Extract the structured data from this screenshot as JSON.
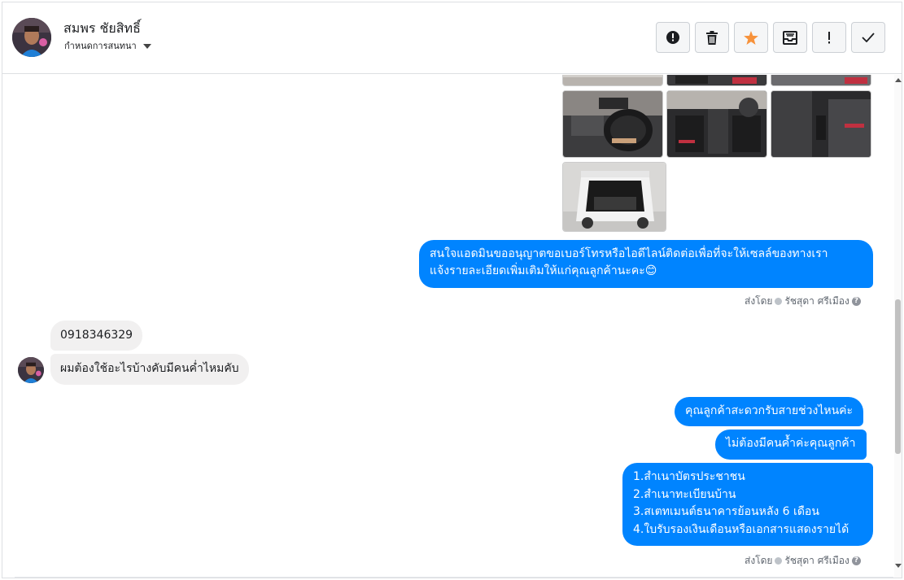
{
  "header": {
    "contact_name": "สมพร ชัยสิทธิ์",
    "label_text": "กำหนดการสนทนา"
  },
  "toolbar": [
    {
      "name": "report-spam-button",
      "icon": "exclamation-circle-icon"
    },
    {
      "name": "delete-button",
      "icon": "trash-icon"
    },
    {
      "name": "star-button",
      "icon": "star-icon",
      "color": "#f7923b"
    },
    {
      "name": "move-to-done-button",
      "icon": "inbox-icon"
    },
    {
      "name": "mark-unread-button",
      "icon": "exclamation-icon"
    },
    {
      "name": "done-button",
      "icon": "checkmark-icon"
    }
  ],
  "messages": {
    "page_1": "สนใจแอดมินขออนุญาตขอเบอร์โทรหรือไอดีไลน์ติดต่อเพื่อที่จะให้เซลล์ของทางเรา",
    "page_1b": "แจ้งรายละเอียดเพิ่มเติมให้แก่คุณลูกค้านะคะ😊",
    "sent_by_1": "ส่งโดย",
    "agent_1": "รัชสุดา ศรีเมือง",
    "customer_1": "0918346329",
    "customer_2": "ผมต้องใช้อะไรบ้างคับมีคนค่ำไหมคับ",
    "page_2": "คุณลูกค้าสะดวกรับสายช่วงไหนค่ะ",
    "page_3": "ไม่ต้องมีคนค้ำค่ะคุณลูกค้า",
    "page_4_lines": [
      "1.สำเนาบัตรประชาชน",
      "2.สำเนาทะเบียนบ้าน",
      "3.สเตทเมนต์ธนาคารย้อนหลัง 6 เดือน",
      "4.ใบรับรองเงินเดือนหรือเอกสารแสดงรายได้"
    ],
    "sent_by_2": "ส่งโดย",
    "agent_2": "รัชสุดา ศรีเมือง"
  },
  "colors": {
    "outgoing_bubble": "#0084ff",
    "incoming_bubble": "#f1f0f0",
    "star": "#f7923b"
  }
}
